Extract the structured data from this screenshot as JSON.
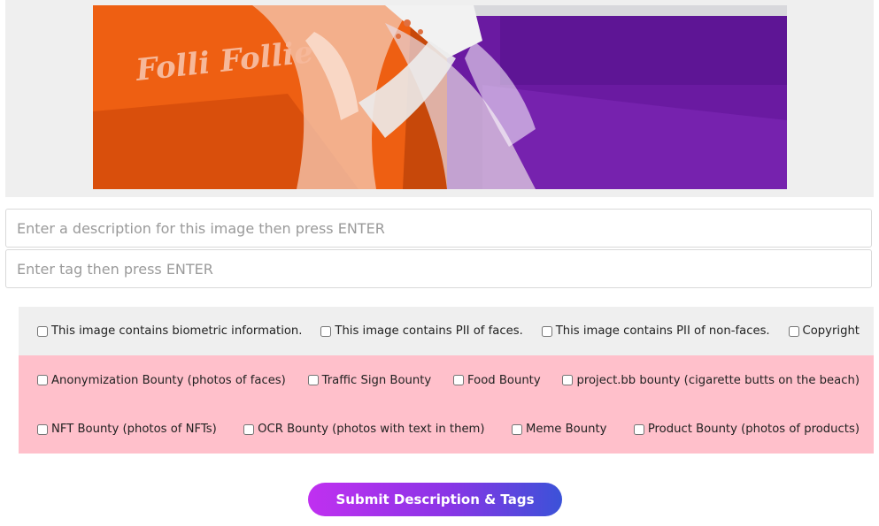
{
  "photo": {
    "brand_text": "Folli Follie",
    "colors": {
      "orange": "#ee5f12",
      "purple": "#6a1aa1",
      "panel": "#efefef"
    }
  },
  "description_input": {
    "placeholder": "Enter a description for this image then press ENTER",
    "value": ""
  },
  "tag_input": {
    "placeholder": "Enter tag then press ENTER",
    "value": ""
  },
  "checkboxes": {
    "row1": [
      "This image contains biometric information.",
      "This image contains PII of faces.",
      "This image contains PII of non-faces.",
      "Copyright"
    ],
    "row2": [
      "Anonymization Bounty (photos of faces)",
      "Traffic Sign Bounty",
      "Food Bounty",
      "project.bb bounty (cigarette butts on the beach)"
    ],
    "row3": [
      "NFT Bounty (photos of NFTs)",
      "OCR Bounty (photos with text in them)",
      "Meme Bounty",
      "Product Bounty (photos of products)"
    ]
  },
  "submit": {
    "label": "Submit Description & Tags"
  },
  "colors": {
    "row_grey": "#efefef",
    "row_pink": "#ffc0cb",
    "button_start": "#c030f0",
    "button_end": "#3b52d8"
  }
}
